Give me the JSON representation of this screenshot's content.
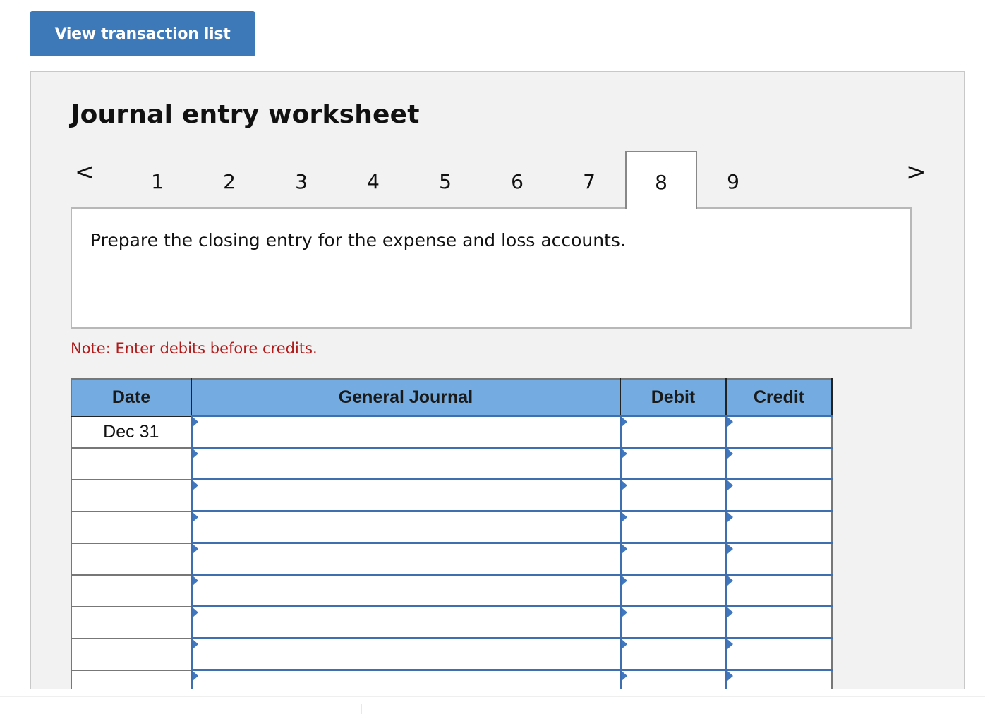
{
  "view_button": {
    "label": "View transaction list"
  },
  "worksheet": {
    "title": "Journal entry worksheet",
    "nav": {
      "prev_icon": "chevron-left-icon",
      "next_icon": "chevron-right-icon",
      "prev_glyph": "<",
      "next_glyph": ">",
      "tabs": [
        "1",
        "2",
        "3",
        "4",
        "5",
        "6",
        "7",
        "8",
        "9"
      ],
      "active_tab": "8"
    },
    "prompt": "Prepare the closing entry for the expense and loss accounts.",
    "note": "Note: Enter debits before credits."
  },
  "journal": {
    "columns": [
      "Date",
      "General Journal",
      "Debit",
      "Credit"
    ],
    "rows": [
      {
        "date": "Dec 31",
        "account": "",
        "debit": "",
        "credit": ""
      },
      {
        "date": "",
        "account": "",
        "debit": "",
        "credit": ""
      },
      {
        "date": "",
        "account": "",
        "debit": "",
        "credit": ""
      },
      {
        "date": "",
        "account": "",
        "debit": "",
        "credit": ""
      },
      {
        "date": "",
        "account": "",
        "debit": "",
        "credit": ""
      },
      {
        "date": "",
        "account": "",
        "debit": "",
        "credit": ""
      },
      {
        "date": "",
        "account": "",
        "debit": "",
        "credit": ""
      },
      {
        "date": "",
        "account": "",
        "debit": "",
        "credit": ""
      },
      {
        "date": "",
        "account": "",
        "debit": "",
        "credit": ""
      }
    ]
  },
  "colors": {
    "button": "#3d78b8",
    "header": "#74abe0",
    "note": "#b01a1a",
    "input_border": "#3f6fae"
  }
}
